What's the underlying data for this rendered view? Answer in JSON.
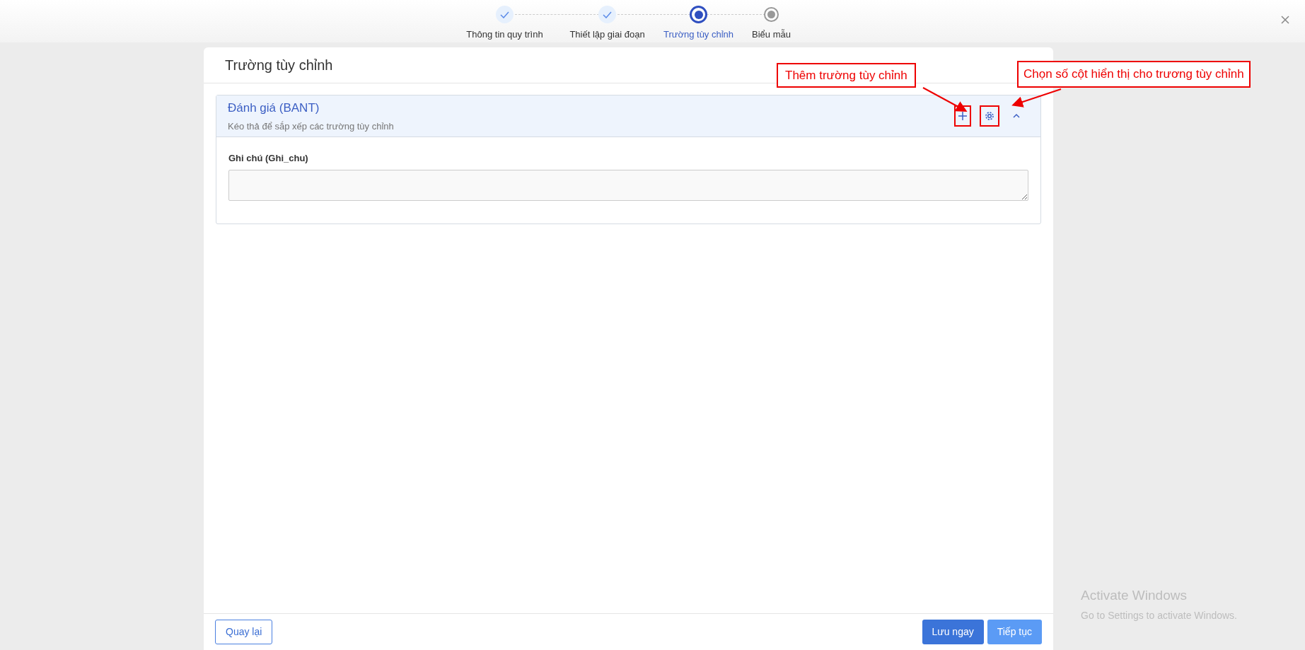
{
  "stepper": {
    "steps": [
      {
        "label": "Thông tin quy trình",
        "kind": "done",
        "selected": false
      },
      {
        "label": "Thiết lập giai đoạn",
        "kind": "done",
        "selected": false
      },
      {
        "label": "Trường tùy chỉnh",
        "kind": "current",
        "selected": true
      },
      {
        "label": "Biểu mẫu",
        "kind": "todo",
        "selected": false
      }
    ]
  },
  "card": {
    "title": "Trường tùy chỉnh",
    "section": {
      "title": "Đánh giá (BANT)",
      "subtitle": "Kéo thả để sắp xếp các trường tùy chỉnh",
      "expanded": true,
      "fields": [
        {
          "label": "Ghi chú (Ghi_chu)"
        }
      ]
    },
    "footer": {
      "back_button": "Quay lại",
      "save_button": "Lưu ngay",
      "next_button": "Tiếp tục"
    }
  },
  "annotations": [
    {
      "text": "Thêm trường tùy chỉnh"
    },
    {
      "text": "Chọn số cột hiển thị cho trương tùy chỉnh"
    }
  ],
  "os_notice": {
    "title": "Activate Windows",
    "text": "Go to Settings to activate Windows."
  }
}
